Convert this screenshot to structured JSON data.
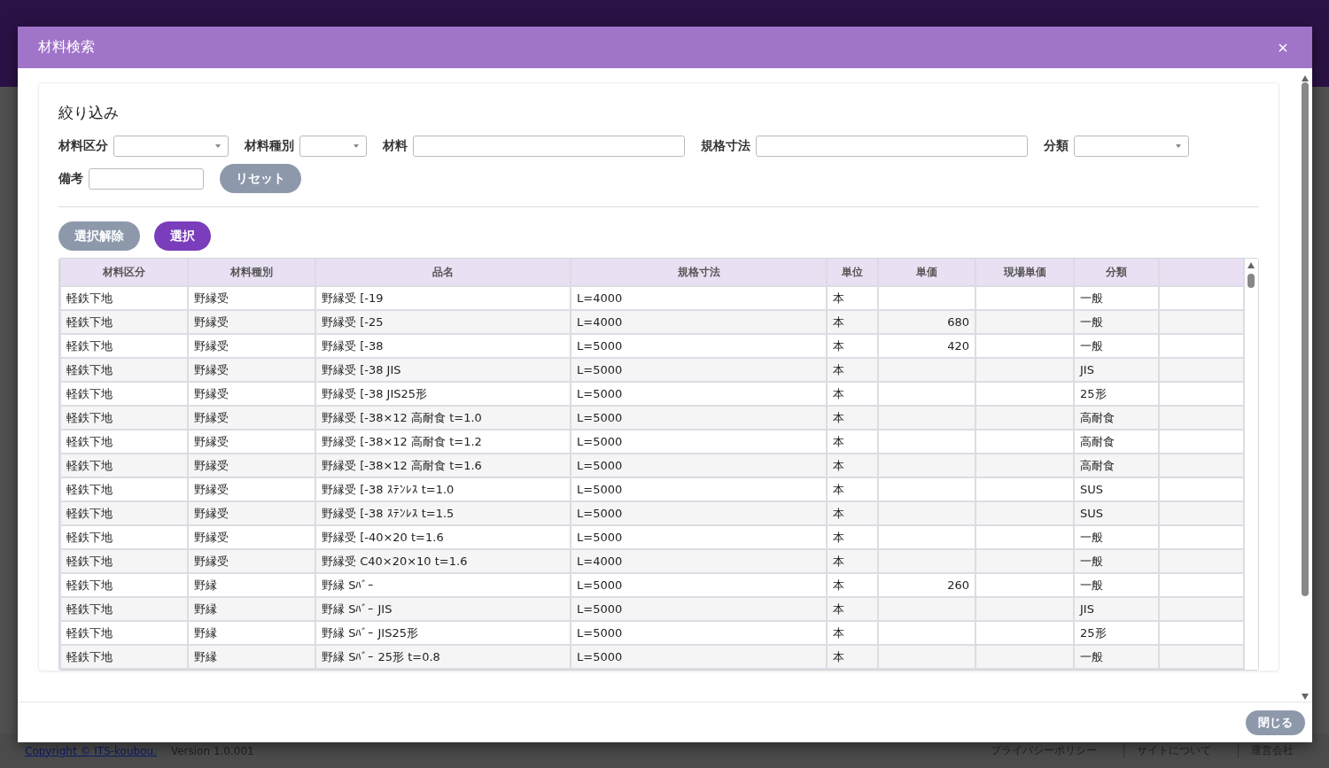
{
  "window": {
    "title": "材料検索"
  },
  "filter": {
    "title": "絞り込み",
    "fields": [
      {
        "label": "材料区分",
        "kind": "select"
      },
      {
        "label": "材料種別",
        "kind": "select"
      },
      {
        "label": "材料",
        "kind": "text"
      },
      {
        "label": "規格寸法",
        "kind": "text"
      },
      {
        "label": "分類",
        "kind": "select"
      },
      {
        "label": "備考",
        "kind": "text"
      }
    ],
    "reset_button": "リセット"
  },
  "actions": [
    {
      "label": "選択解除",
      "kind": "secondary"
    },
    {
      "label": "選択",
      "kind": "primary"
    }
  ],
  "table": {
    "columns": [
      "材料区分",
      "材料種別",
      "品名",
      "規格寸法",
      "単位",
      "単価",
      "現場単価",
      "分類"
    ],
    "rows": [
      {
        "category": "軽鉄下地",
        "type": "野縁受",
        "name": "野縁受 [-19",
        "size": "L=4000",
        "unit": "本",
        "class": "一般"
      },
      {
        "category": "軽鉄下地",
        "type": "野縁受",
        "name": "野縁受 [-25",
        "size": "L=4000",
        "unit": "本",
        "price": "680",
        "class": "一般"
      },
      {
        "category": "軽鉄下地",
        "type": "野縁受",
        "name": "野縁受 [-38",
        "size": "L=5000",
        "unit": "本",
        "price": "420",
        "class": "一般"
      },
      {
        "category": "軽鉄下地",
        "type": "野縁受",
        "name": "野縁受 [-38 JIS",
        "size": "L=5000",
        "unit": "本",
        "class": "JIS"
      },
      {
        "category": "軽鉄下地",
        "type": "野縁受",
        "name": "野縁受 [-38 JIS25形",
        "size": "L=5000",
        "unit": "本",
        "class": "25形"
      },
      {
        "category": "軽鉄下地",
        "type": "野縁受",
        "name": "野縁受 [-38×12 高耐食 t=1.0",
        "size": "L=5000",
        "unit": "本",
        "class": "高耐食"
      },
      {
        "category": "軽鉄下地",
        "type": "野縁受",
        "name": "野縁受 [-38×12 高耐食 t=1.2",
        "size": "L=5000",
        "unit": "本",
        "class": "高耐食"
      },
      {
        "category": "軽鉄下地",
        "type": "野縁受",
        "name": "野縁受 [-38×12 高耐食 t=1.6",
        "size": "L=5000",
        "unit": "本",
        "class": "高耐食"
      },
      {
        "category": "軽鉄下地",
        "type": "野縁受",
        "name": "野縁受 [-38 ｽﾃﾝﾚｽ t=1.0",
        "size": "L=5000",
        "unit": "本",
        "class": "SUS"
      },
      {
        "category": "軽鉄下地",
        "type": "野縁受",
        "name": "野縁受 [-38 ｽﾃﾝﾚｽ t=1.5",
        "size": "L=5000",
        "unit": "本",
        "class": "SUS"
      },
      {
        "category": "軽鉄下地",
        "type": "野縁受",
        "name": "野縁受 [-40×20 t=1.6",
        "size": "L=5000",
        "unit": "本",
        "class": "一般"
      },
      {
        "category": "軽鉄下地",
        "type": "野縁受",
        "name": "野縁受 C40×20×10 t=1.6",
        "size": "L=4000",
        "unit": "本",
        "class": "一般"
      },
      {
        "category": "軽鉄下地",
        "type": "野縁",
        "name": "野縁 Sﾊﾞｰ",
        "size": "L=5000",
        "unit": "本",
        "price": "260",
        "class": "一般"
      },
      {
        "category": "軽鉄下地",
        "type": "野縁",
        "name": "野縁 Sﾊﾞｰ JIS",
        "size": "L=5000",
        "unit": "本",
        "class": "JIS"
      },
      {
        "category": "軽鉄下地",
        "type": "野縁",
        "name": "野縁 Sﾊﾞｰ JIS25形",
        "size": "L=5000",
        "unit": "本",
        "class": "25形"
      },
      {
        "category": "軽鉄下地",
        "type": "野縁",
        "name": "野縁 Sﾊﾞｰ 25形 t=0.8",
        "size": "L=5000",
        "unit": "本",
        "class": "一般"
      }
    ]
  },
  "close_button": "閉じる",
  "page_footer": {
    "copyright": "Copyright © ITS-koubou.",
    "version": "Version 1.0.001",
    "links": [
      "プライバシーポリシー",
      "サイトについて",
      "運営会社"
    ]
  }
}
